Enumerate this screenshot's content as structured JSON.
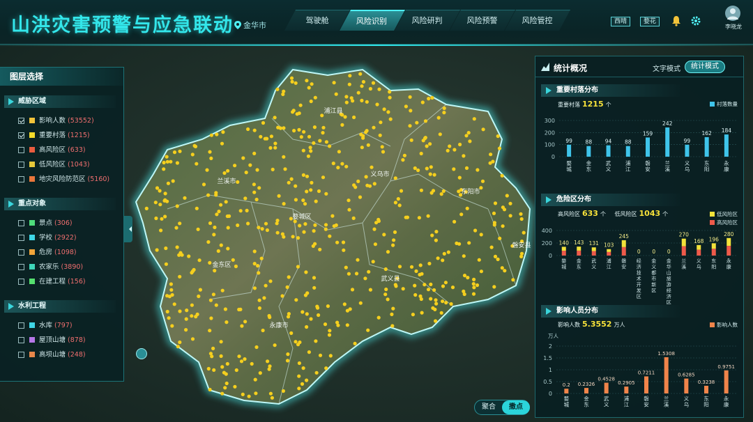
{
  "header": {
    "title": "山洪灾害预警与应急联动",
    "location": "金华市",
    "nav": [
      "驾驶舱",
      "风险识别",
      "风险研判",
      "风险预警",
      "风险管控"
    ],
    "nav_active": 1,
    "weather_buttons": [
      "西晴",
      "婺花"
    ],
    "user": "李晓龙"
  },
  "layer_panel": {
    "title": "图层选择",
    "groups": [
      {
        "title": "威胁区域",
        "items": [
          {
            "label": "影响人数",
            "count": "(53552)",
            "checked": true,
            "color": "#f2c33a"
          },
          {
            "label": "重要村落",
            "count": "(1215)",
            "checked": true,
            "color": "#f3da2a"
          },
          {
            "label": "高风险区",
            "count": "(633)",
            "checked": false,
            "color": "#e95c3f"
          },
          {
            "label": "低风险区",
            "count": "(1043)",
            "checked": false,
            "color": "#e6c83a"
          },
          {
            "label": "地灾风险防范区",
            "count": "(5160)",
            "checked": false,
            "color": "#e9763b"
          }
        ]
      },
      {
        "title": "重点对象",
        "items": [
          {
            "label": "景点",
            "count": "(306)",
            "checked": false,
            "color": "#4fdc7c"
          },
          {
            "label": "学校",
            "count": "(2922)",
            "checked": false,
            "color": "#3fd6e6"
          },
          {
            "label": "危房",
            "count": "(1098)",
            "checked": false,
            "color": "#f0a53a"
          },
          {
            "label": "农家乐",
            "count": "(3890)",
            "checked": false,
            "color": "#3fd6b9"
          },
          {
            "label": "在建工程",
            "count": "(156)",
            "checked": false,
            "color": "#55e06f"
          }
        ]
      },
      {
        "title": "水利工程",
        "items": [
          {
            "label": "水库",
            "count": "(797)",
            "checked": false,
            "color": "#3fd6e6"
          },
          {
            "label": "屋顶山塘",
            "count": "(878)",
            "checked": false,
            "color": "#b577e8"
          },
          {
            "label": "高坝山塘",
            "count": "(248)",
            "checked": false,
            "color": "#e8874a"
          }
        ]
      }
    ]
  },
  "map_labels": [
    "浦江县",
    "兰溪市",
    "义乌市",
    "东阳市",
    "婺城区",
    "金东区",
    "武义县",
    "永康市",
    "磐安县"
  ],
  "stats_panel": {
    "title": "统计概况",
    "mode_text": "文字模式",
    "mode_stat": "统计模式",
    "villages": {
      "title": "重要村落分布",
      "summary_label": "重要村落",
      "summary_value": "1215",
      "summary_unit": "个",
      "legend": "村落数量"
    },
    "risk": {
      "title": "危险区分布",
      "high_label": "高风险区",
      "high_value": "633",
      "low_label": "低风险区",
      "low_value": "1043",
      "unit": "个",
      "legend_low": "低风险区",
      "legend_high": "高风险区"
    },
    "people": {
      "title": "影响人员分布",
      "summary_label": "影响人数",
      "summary_value": "5.3552",
      "summary_unit": "万人",
      "legend": "影响人数",
      "yunit": "万人"
    }
  },
  "chart_data": [
    {
      "type": "bar",
      "title": "重要村落分布",
      "categories": [
        "婺城",
        "金东",
        "武义",
        "浦江",
        "磐安",
        "兰溪",
        "义乌",
        "东阳",
        "永康"
      ],
      "series": [
        {
          "name": "村落数量",
          "values": [
            99,
            88,
            94,
            88,
            159,
            242,
            99,
            162,
            184
          ]
        }
      ],
      "ylim": [
        0,
        300
      ],
      "yticks": [
        0,
        100,
        200,
        300
      ],
      "color": "#3fc4ea"
    },
    {
      "type": "bar",
      "title": "危险区分布",
      "categories": [
        "婺城",
        "金东",
        "武义",
        "浦江",
        "磐安",
        "经济技术开发区",
        "金义都市新区",
        "金华山旅游经济区",
        "兰溪",
        "义乌",
        "东阳",
        "永康"
      ],
      "totals": [
        140,
        143,
        131,
        103,
        245,
        0,
        0,
        0,
        270,
        168,
        196,
        280
      ],
      "series": [
        {
          "name": "低风险区"
        },
        {
          "name": "高风险区"
        }
      ],
      "ylim": [
        0,
        400
      ],
      "yticks": [
        0,
        200,
        400
      ],
      "colors": {
        "low": "#f2e23a",
        "high": "#ee5a4a"
      }
    },
    {
      "type": "bar",
      "title": "影响人员分布",
      "categories": [
        "婺城",
        "金东",
        "武义",
        "浦江",
        "磐安",
        "兰溪",
        "义乌",
        "东阳",
        "永康"
      ],
      "series": [
        {
          "name": "影响人数",
          "values": [
            0.2,
            0.2326,
            0.4528,
            0.2905,
            0.7211,
            1.5308,
            0.6285,
            0.3238,
            0.9751
          ]
        }
      ],
      "value_labels": [
        "0.2",
        "0.2326",
        "0.4528",
        "0.2905",
        "0.7211",
        "1.5308",
        "0.6285",
        "0.3238",
        "0.9751"
      ],
      "ylim": [
        0,
        2
      ],
      "yticks": [
        "0",
        "0.5",
        "1",
        "1.5",
        "2"
      ],
      "ylabel": "万人",
      "color": "#f0844a"
    }
  ],
  "cluster_toggle": {
    "options": [
      "聚合",
      "撒点"
    ],
    "active": 1
  }
}
